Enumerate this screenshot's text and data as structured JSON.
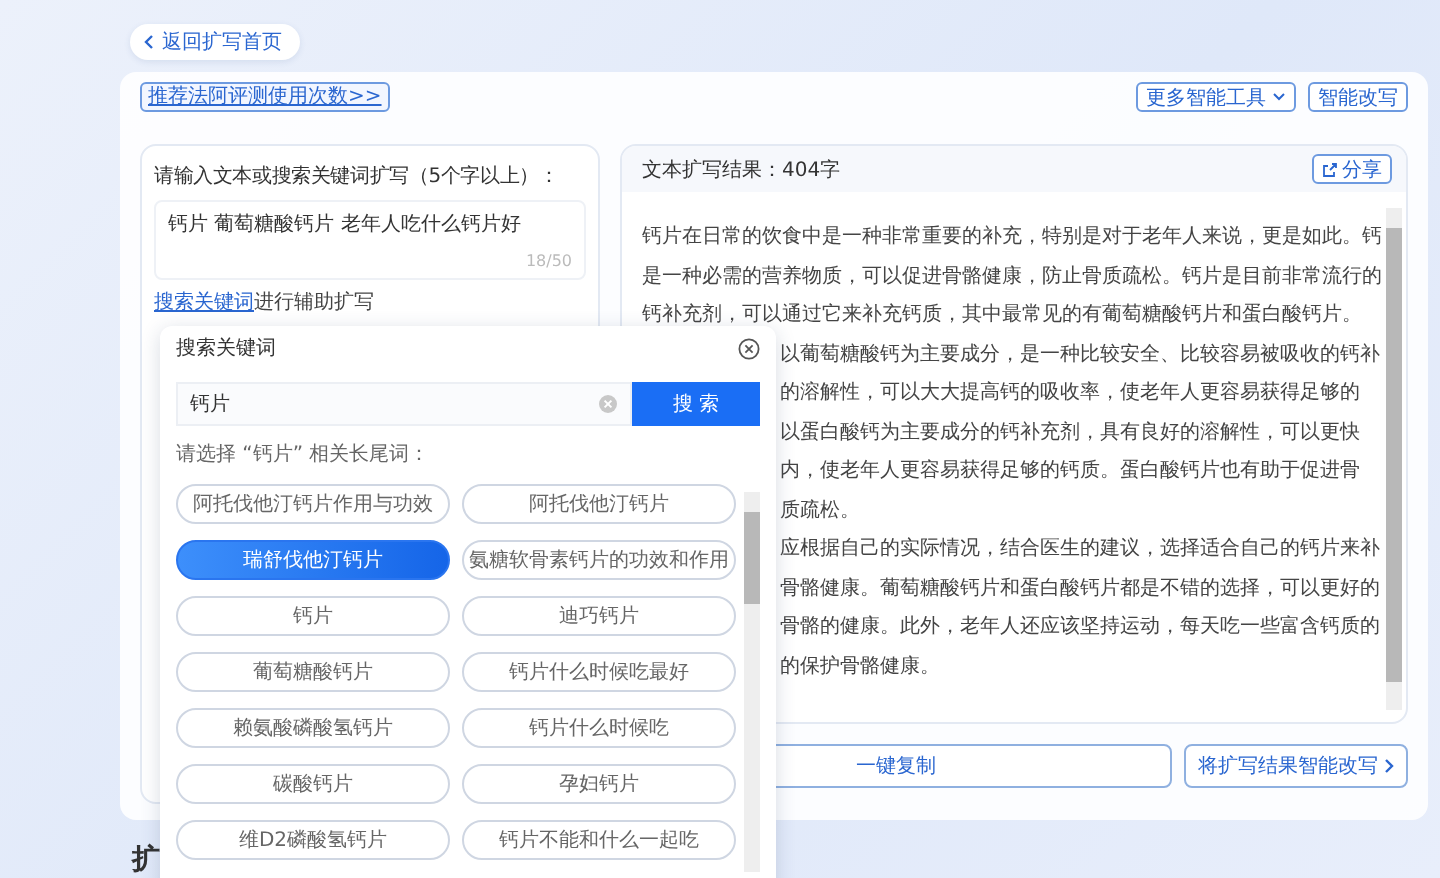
{
  "back_button": {
    "label": "返回扩写首页"
  },
  "toolbar": {
    "link": "推荐法阿评测使用次数>>",
    "buttons": [
      {
        "label": "更多智能工具",
        "kind": "dropdown"
      },
      {
        "label": "智能改写",
        "kind": "plain"
      }
    ]
  },
  "input_panel": {
    "prompt": "请输入文本或搜索关键词扩写（5个字以上）：",
    "value": "钙片 葡萄糖酸钙片 老年人吃什么钙片好",
    "counter": "18/50",
    "link": "搜索关键词",
    "link_suffix": "进行辅助扩写"
  },
  "result_panel": {
    "title": "文本扩写结果：404字",
    "share_button": "分享",
    "paragraphs": [
      {
        "kind": "full",
        "lines": [
          "钙片在日常的饮食中是一种非常重要的补充，特别是对于老年人来说，更是如此。钙",
          "是一种必需的营养物质，可以促进骨骼健康，防止骨质疏松。钙片是目前非常流行的",
          "钙补充剂，可以通过它来补充钙质，其中最常见的有葡萄糖酸钙片和蛋白酸钙片。"
        ]
      },
      {
        "kind": "cut",
        "lines": [
          "以葡萄糖酸钙为主要成分，是一种比较安全、比较容易被吸收的钙补",
          "的溶解性，可以大大提高钙的吸收率，使老年人更容易获得足够的"
        ]
      },
      {
        "kind": "cut",
        "lines": [
          "以蛋白酸钙为主要成分的钙补充剂，具有良好的溶解性，可以更快",
          "内，使老年人更容易获得足够的钙质。蛋白酸钙片也有助于促进骨",
          "质疏松。"
        ]
      },
      {
        "kind": "cut",
        "lines": [
          "应根据自己的实际情况，结合医生的建议，选择适合自己的钙片来补",
          "骨骼健康。葡萄糖酸钙片和蛋白酸钙片都是不错的选择，可以更好的",
          "骨骼的健康。此外，老年人还应该坚持运动，每天吃一些富含钙质的",
          "的保护骨骼健康。"
        ]
      }
    ]
  },
  "actions": [
    {
      "label": "一键复制",
      "kind": "plain"
    },
    {
      "label": "将扩写结果智能改写",
      "kind": "next"
    }
  ],
  "section_heading": "扩",
  "keyword_popup": {
    "title": "搜索关键词",
    "query": "钙片",
    "search_button": "搜 索",
    "hint": "请选择 “钙片” 相关长尾词：",
    "suggestions": [
      {
        "label": "阿托伐他汀钙片作用与功效",
        "selected": false
      },
      {
        "label": "阿托伐他汀钙片",
        "selected": false
      },
      {
        "label": "瑞舒伐他汀钙片",
        "selected": true
      },
      {
        "label": "氨糖软骨素钙片的功效和作用",
        "selected": false
      },
      {
        "label": "钙片",
        "selected": false
      },
      {
        "label": "迪巧钙片",
        "selected": false
      },
      {
        "label": "葡萄糖酸钙片",
        "selected": false
      },
      {
        "label": "钙片什么时候吃最好",
        "selected": false
      },
      {
        "label": "赖氨酸磷酸氢钙片",
        "selected": false
      },
      {
        "label": "钙片什么时候吃",
        "selected": false
      },
      {
        "label": "碳酸钙片",
        "selected": false
      },
      {
        "label": "孕妇钙片",
        "selected": false
      },
      {
        "label": "维D2磷酸氢钙片",
        "selected": false
      },
      {
        "label": "钙片不能和什么一起吃",
        "selected": false
      }
    ]
  }
}
